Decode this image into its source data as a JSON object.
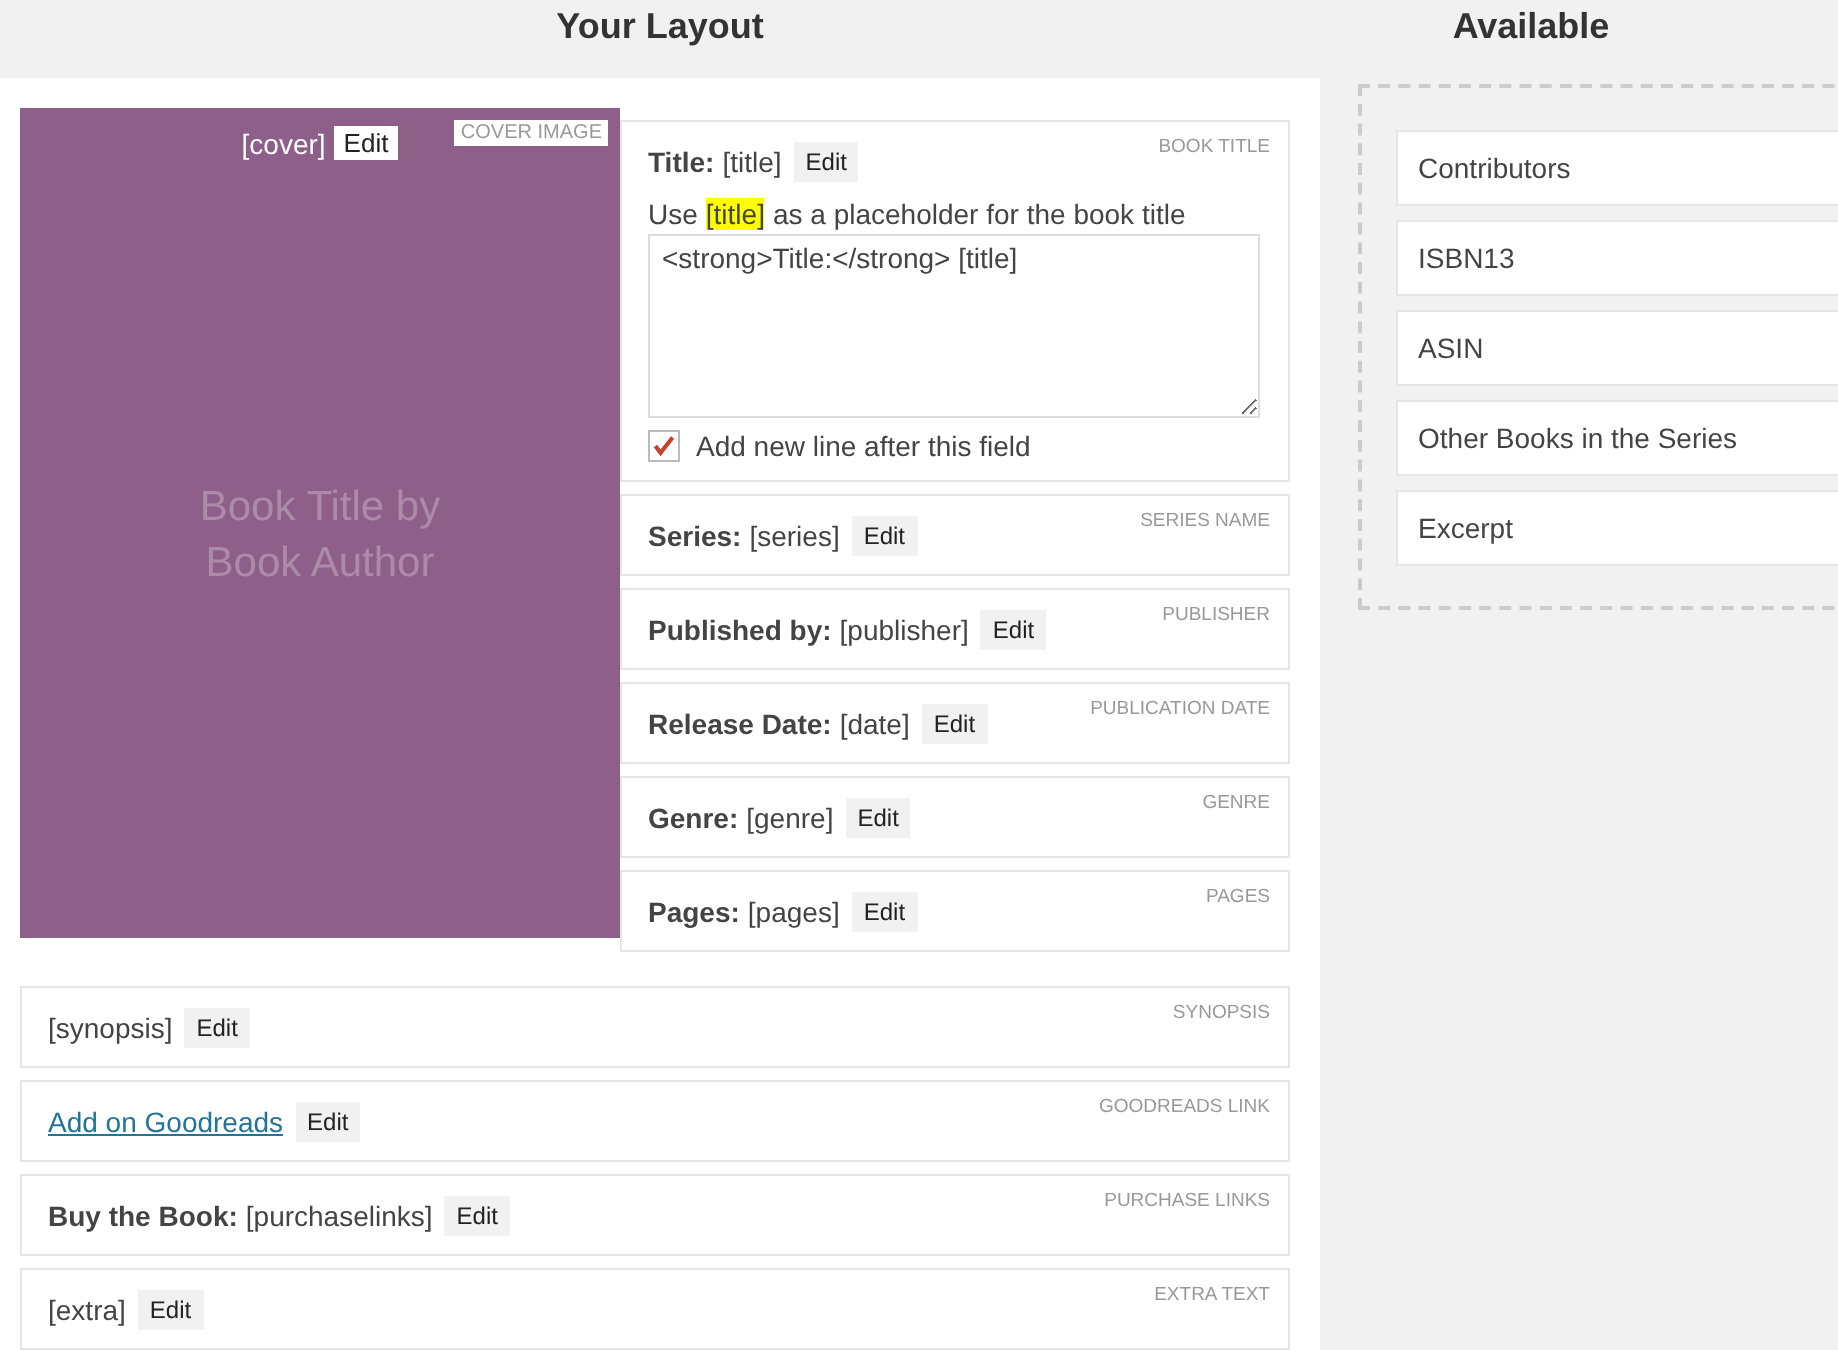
{
  "layout": {
    "heading": "Your Layout",
    "cover": {
      "placeholder": "[cover]",
      "edit": "Edit",
      "tag": "COVER IMAGE",
      "art_text": "Book Title by Book Author"
    },
    "side_fields": [
      {
        "kind": "expanded",
        "label": "Title:",
        "value": "[title]",
        "edit": "Edit",
        "tag": "BOOK TITLE",
        "help_before": "Use",
        "help_code": "[title]",
        "help_after": "as a placeholder for the book title",
        "template": "<strong>Title:</strong> [title]",
        "newline_label": "Add new line after this field",
        "checked": true
      },
      {
        "kind": "plain",
        "label": "Series:",
        "value": "[series]",
        "edit": "Edit",
        "tag": "SERIES NAME"
      },
      {
        "kind": "plain",
        "label": "Published by:",
        "value": "[publisher]",
        "edit": "Edit",
        "tag": "PUBLISHER"
      },
      {
        "kind": "plain",
        "label": "Release Date:",
        "value": "[date]",
        "edit": "Edit",
        "tag": "PUBLICATION DATE"
      },
      {
        "kind": "plain",
        "label": "Genre:",
        "value": "[genre]",
        "edit": "Edit",
        "tag": "GENRE"
      },
      {
        "kind": "plain",
        "label": "Pages:",
        "value": "[pages]",
        "edit": "Edit",
        "tag": "PAGES"
      }
    ],
    "wide_fields": [
      {
        "kind": "plain",
        "value": "[synopsis]",
        "edit": "Edit",
        "tag": "SYNOPSIS"
      },
      {
        "kind": "link",
        "value": "Add on Goodreads",
        "edit": "Edit",
        "tag": "GOODREADS LINK"
      },
      {
        "kind": "plain",
        "label": "Buy the Book:",
        "value": "[purchaselinks]",
        "edit": "Edit",
        "tag": "PURCHASE LINKS"
      },
      {
        "kind": "plain",
        "value": "[extra]",
        "edit": "Edit",
        "tag": "EXTRA TEXT"
      }
    ]
  },
  "available": {
    "heading": "Available",
    "items": [
      "Contributors",
      "ISBN13",
      "ASIN",
      "Other Books in the Series",
      "Excerpt"
    ]
  }
}
